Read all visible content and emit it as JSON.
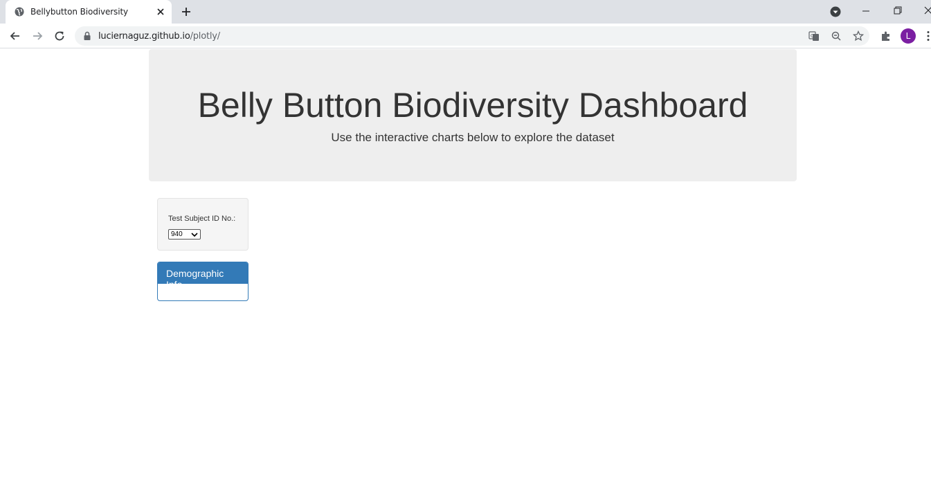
{
  "browser": {
    "tab_title": "Bellybutton Biodiversity",
    "url_host": "luciernaguz.github.io",
    "url_path": "/plotly/",
    "profile_initial": "L"
  },
  "page": {
    "title": "Belly Button Biodiversity Dashboard",
    "subtitle": "Use the interactive charts below to explore the dataset",
    "selector_label": "Test Subject ID No.:",
    "selected_id": "940",
    "panel_title": "Demographic Info"
  },
  "colors": {
    "panel_primary": "#337ab7",
    "jumbotron_bg": "#eeeeee",
    "avatar": "#7b1fa2"
  },
  "icons": [
    "globe-icon",
    "close-icon",
    "plus-icon",
    "tab-search-icon",
    "minimize-icon",
    "restore-icon",
    "back-icon",
    "forward-icon",
    "reload-icon",
    "lock-icon",
    "translate-icon",
    "zoom-icon",
    "star-icon",
    "extensions-icon",
    "more-icon",
    "chevron-down-icon"
  ]
}
